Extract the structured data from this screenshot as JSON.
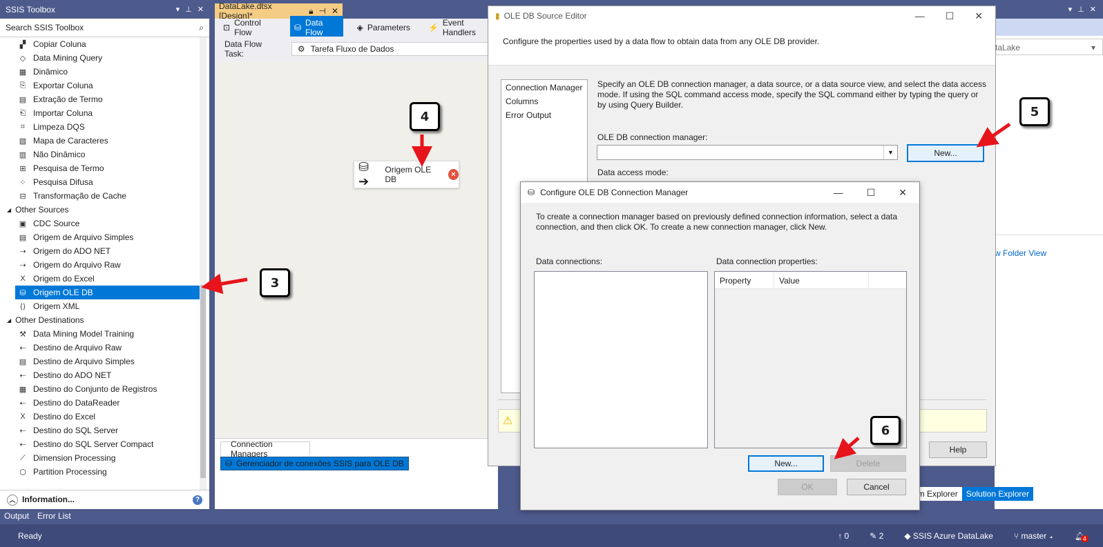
{
  "toolbox": {
    "title": "SSIS Toolbox",
    "search_placeholder": "Search SSIS Toolbox",
    "transform_items": [
      {
        "label": "Copiar Coluna",
        "icon": "copy-column-icon",
        "glyph": "▞"
      },
      {
        "label": "Data Mining Query",
        "icon": "data-mining-icon",
        "glyph": "◇"
      },
      {
        "label": "Dinâmico",
        "icon": "pivot-icon",
        "glyph": "▦"
      },
      {
        "label": "Exportar Coluna",
        "icon": "export-column-icon",
        "glyph": "⎘"
      },
      {
        "label": "Extração de Termo",
        "icon": "term-extraction-icon",
        "glyph": "▤"
      },
      {
        "label": "Importar Coluna",
        "icon": "import-column-icon",
        "glyph": "⎗"
      },
      {
        "label": "Limpeza DQS",
        "icon": "dqs-cleansing-icon",
        "glyph": "⌗"
      },
      {
        "label": "Mapa de Caracteres",
        "icon": "character-map-icon",
        "glyph": "▧"
      },
      {
        "label": "Não Dinâmico",
        "icon": "unpivot-icon",
        "glyph": "▥"
      },
      {
        "label": "Pesquisa de Termo",
        "icon": "term-lookup-icon",
        "glyph": "⊞"
      },
      {
        "label": "Pesquisa Difusa",
        "icon": "fuzzy-lookup-icon",
        "glyph": "⁘"
      },
      {
        "label": "Transformação de Cache",
        "icon": "cache-transform-icon",
        "glyph": "⊟"
      }
    ],
    "group_sources": "Other Sources",
    "source_items": [
      {
        "label": "CDC Source",
        "icon": "cdc-source-icon",
        "glyph": "▣"
      },
      {
        "label": "Origem de Arquivo Simples",
        "icon": "flat-file-source-icon",
        "glyph": "▤"
      },
      {
        "label": "Origem do ADO NET",
        "icon": "ado-net-source-icon",
        "glyph": "⇢"
      },
      {
        "label": "Origem do Arquivo Raw",
        "icon": "raw-file-source-icon",
        "glyph": "⇢"
      },
      {
        "label": "Origem do Excel",
        "icon": "excel-source-icon",
        "glyph": "X"
      },
      {
        "label": "Origem OLE DB",
        "icon": "ole-db-source-icon",
        "glyph": "⛁",
        "selected": true
      },
      {
        "label": "Origem XML",
        "icon": "xml-source-icon",
        "glyph": "⟨⟩"
      }
    ],
    "group_destinations": "Other Destinations",
    "dest_items": [
      {
        "label": "Data Mining Model Training",
        "icon": "model-training-icon",
        "glyph": "⚒"
      },
      {
        "label": "Destino de Arquivo Raw",
        "icon": "raw-file-dest-icon",
        "glyph": "⇠"
      },
      {
        "label": "Destino de Arquivo Simples",
        "icon": "flat-file-dest-icon",
        "glyph": "▤"
      },
      {
        "label": "Destino do ADO NET",
        "icon": "ado-net-dest-icon",
        "glyph": "⇠"
      },
      {
        "label": "Destino do Conjunto de Registros",
        "icon": "recordset-dest-icon",
        "glyph": "▦"
      },
      {
        "label": "Destino do DataReader",
        "icon": "datareader-dest-icon",
        "glyph": "⇠"
      },
      {
        "label": "Destino do Excel",
        "icon": "excel-dest-icon",
        "glyph": "X"
      },
      {
        "label": "Destino do SQL Server",
        "icon": "sql-server-dest-icon",
        "glyph": "⇠"
      },
      {
        "label": "Destino do SQL Server Compact",
        "icon": "sql-compact-dest-icon",
        "glyph": "⇠"
      },
      {
        "label": "Dimension Processing",
        "icon": "dimension-processing-icon",
        "glyph": "⟋"
      },
      {
        "label": "Partition Processing",
        "icon": "partition-processing-icon",
        "glyph": "⬡"
      }
    ],
    "information": "Information..."
  },
  "bottom_tabs": [
    "Output",
    "Error List"
  ],
  "status": {
    "ready": "Ready",
    "up_count": "0",
    "edit_count": "2",
    "project": "SSIS Azure DataLake",
    "branch": "master",
    "notif": "4"
  },
  "document": {
    "tab_title": "DataLake.dtsx [Design]*",
    "tabs": [
      {
        "label": "Control Flow",
        "icon": "control-flow-icon",
        "glyph": "⊡"
      },
      {
        "label": "Data Flow",
        "icon": "data-flow-icon",
        "glyph": "⛁",
        "active": true
      },
      {
        "label": "Parameters",
        "icon": "parameters-icon",
        "glyph": "◈"
      },
      {
        "label": "Event Handlers",
        "icon": "event-handlers-icon",
        "glyph": "⚡"
      }
    ],
    "task_label": "Data Flow Task:",
    "task_value": "Tarefa Fluxo de Dados",
    "node_label": "Origem OLE DB",
    "conn_managers_tab": "Connection Managers",
    "conn_manager_item": "Gerenciador de conexões SSIS para OLE DB"
  },
  "right_panel": {
    "combo_text": "taLake",
    "link_text": "w Folder View",
    "tab_team": "am Explorer",
    "tab_solution": "Solution Explorer"
  },
  "editor": {
    "title": "OLE DB Source Editor",
    "description": "Configure the properties used by a data flow to obtain data from any OLE DB provider.",
    "nav": [
      "Connection Manager",
      "Columns",
      "Error Output"
    ],
    "help_text": "Specify an OLE DB connection manager, a data source, or a data source view, and select the data access mode. If using the SQL command access mode, specify the SQL command either by typing the query or by using Query Builder.",
    "conn_label": "OLE DB connection manager:",
    "conn_value": "",
    "new_label": "New...",
    "access_label": "Data access mode:",
    "help_button": "Help"
  },
  "config": {
    "title": "Configure OLE DB Connection Manager",
    "description": "To create a connection manager based on previously defined connection information, select a data connection, and then click OK. To create a new connection manager, click New.",
    "connections_label": "Data connections:",
    "properties_label": "Data connection properties:",
    "col_property": "Property",
    "col_value": "Value",
    "new_label": "New...",
    "delete_label": "Delete",
    "ok_label": "OK",
    "cancel_label": "Cancel"
  },
  "callouts": [
    "3",
    "4",
    "5",
    "6"
  ],
  "colors": {
    "accent": "#0078d7",
    "chrome": "#4d5a8c",
    "arrow": "#e8141b"
  }
}
